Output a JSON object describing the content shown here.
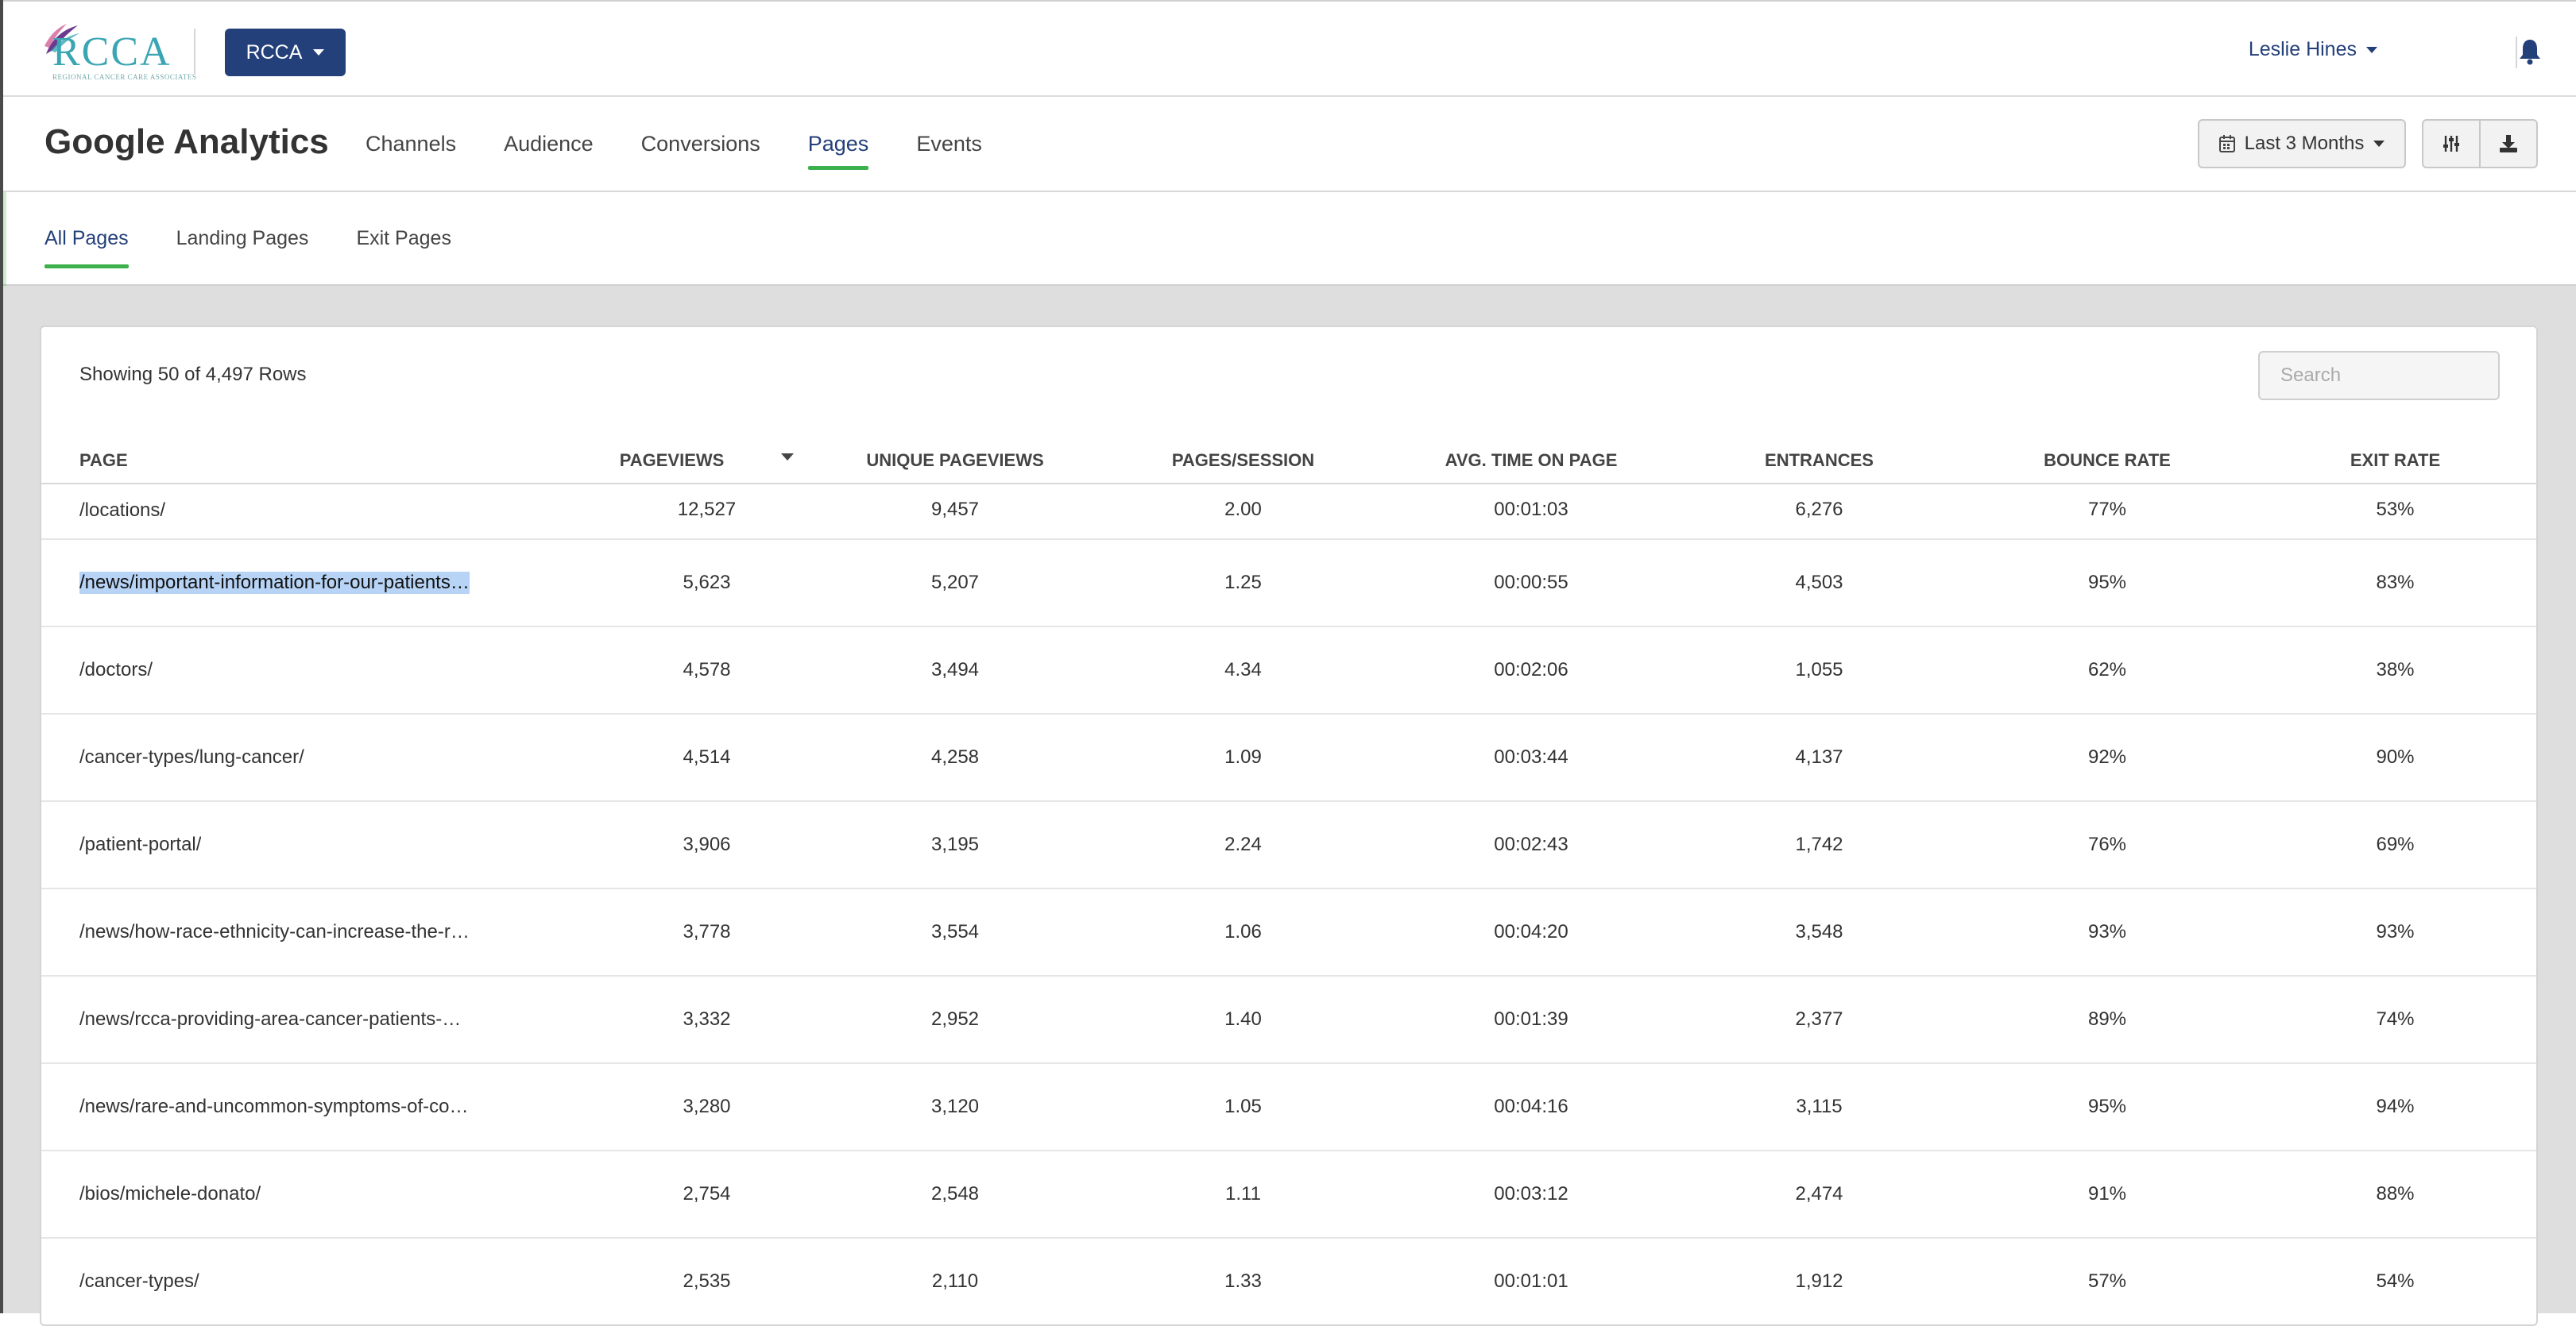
{
  "app": {
    "logo_text": "RCCA",
    "logo_subtext": "REGIONAL CANCER CARE ASSOCIATES",
    "org_selector": "RCCA",
    "user_name": "Leslie Hines"
  },
  "header": {
    "title": "Google Analytics",
    "tabs": [
      {
        "label": "Channels"
      },
      {
        "label": "Audience"
      },
      {
        "label": "Conversions"
      },
      {
        "label": "Pages"
      },
      {
        "label": "Events"
      }
    ],
    "active_tab": "Pages",
    "date_range": "Last 3 Months",
    "icons": [
      "calendar-icon",
      "sliders-icon",
      "download-icon",
      "bell-icon"
    ]
  },
  "subtabs": [
    {
      "label": "All Pages"
    },
    {
      "label": "Landing Pages"
    },
    {
      "label": "Exit Pages"
    }
  ],
  "active_subtab": "All Pages",
  "table": {
    "showing": "Showing 50 of 4,497 Rows",
    "search_placeholder": "Search",
    "columns": [
      "PAGE",
      "PAGEVIEWS",
      "UNIQUE PAGEVIEWS",
      "PAGES/SESSION",
      "AVG. TIME ON PAGE",
      "ENTRANCES",
      "BOUNCE RATE",
      "EXIT RATE"
    ],
    "sorted_column": "PAGEVIEWS",
    "rows": [
      {
        "page": "/locations/",
        "pageviews": "12,527",
        "unique": "9,457",
        "pps": "2.00",
        "time": "00:01:03",
        "entrances": "6,276",
        "bounce": "77%",
        "exit": "53%"
      },
      {
        "page": "/news/important-information-for-our-patients…",
        "pageviews": "5,623",
        "unique": "5,207",
        "pps": "1.25",
        "time": "00:00:55",
        "entrances": "4,503",
        "bounce": "95%",
        "exit": "83%"
      },
      {
        "page": "/doctors/",
        "pageviews": "4,578",
        "unique": "3,494",
        "pps": "4.34",
        "time": "00:02:06",
        "entrances": "1,055",
        "bounce": "62%",
        "exit": "38%"
      },
      {
        "page": "/cancer-types/lung-cancer/",
        "pageviews": "4,514",
        "unique": "4,258",
        "pps": "1.09",
        "time": "00:03:44",
        "entrances": "4,137",
        "bounce": "92%",
        "exit": "90%"
      },
      {
        "page": "/patient-portal/",
        "pageviews": "3,906",
        "unique": "3,195",
        "pps": "2.24",
        "time": "00:02:43",
        "entrances": "1,742",
        "bounce": "76%",
        "exit": "69%"
      },
      {
        "page": "/news/how-race-ethnicity-can-increase-the-r…",
        "pageviews": "3,778",
        "unique": "3,554",
        "pps": "1.06",
        "time": "00:04:20",
        "entrances": "3,548",
        "bounce": "93%",
        "exit": "93%"
      },
      {
        "page": "/news/rcca-providing-area-cancer-patients-…",
        "pageviews": "3,332",
        "unique": "2,952",
        "pps": "1.40",
        "time": "00:01:39",
        "entrances": "2,377",
        "bounce": "89%",
        "exit": "74%"
      },
      {
        "page": "/news/rare-and-uncommon-symptoms-of-co…",
        "pageviews": "3,280",
        "unique": "3,120",
        "pps": "1.05",
        "time": "00:04:16",
        "entrances": "3,115",
        "bounce": "95%",
        "exit": "94%"
      },
      {
        "page": "/bios/michele-donato/",
        "pageviews": "2,754",
        "unique": "2,548",
        "pps": "1.11",
        "time": "00:03:12",
        "entrances": "2,474",
        "bounce": "91%",
        "exit": "88%"
      },
      {
        "page": "/cancer-types/",
        "pageviews": "2,535",
        "unique": "2,110",
        "pps": "1.33",
        "time": "00:01:01",
        "entrances": "1,912",
        "bounce": "57%",
        "exit": "54%"
      }
    ]
  },
  "colors": {
    "brand_navy": "#24407a",
    "active_underline": "#3cb04a",
    "logo_teal": "#3aa6b3",
    "selection_highlight": "#b7d3f5"
  }
}
